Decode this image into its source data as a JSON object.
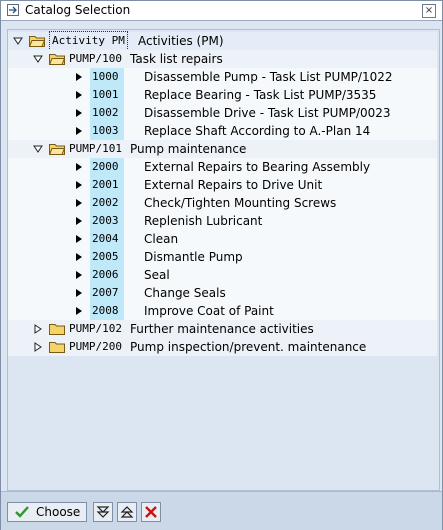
{
  "window": {
    "title": "Catalog Selection"
  },
  "root": {
    "code": "Activity PM",
    "desc": "Activities (PM)"
  },
  "groups": [
    {
      "code": "PUMP/100",
      "desc": "Task list repairs",
      "expanded": true,
      "items": [
        {
          "num": "1000",
          "desc": "Disassemble Pump - Task List PUMP/1022"
        },
        {
          "num": "1001",
          "desc": "Replace Bearing - Task List PUMP/3535"
        },
        {
          "num": "1002",
          "desc": "Disassemble Drive - Task List PUMP/0023"
        },
        {
          "num": "1003",
          "desc": "Replace Shaft According to A.-Plan 14"
        }
      ]
    },
    {
      "code": "PUMP/101",
      "desc": "Pump maintenance",
      "expanded": true,
      "items": [
        {
          "num": "2000",
          "desc": "External Repairs to Bearing Assembly"
        },
        {
          "num": "2001",
          "desc": "External Repairs to Drive Unit"
        },
        {
          "num": "2002",
          "desc": "Check/Tighten Mounting Screws"
        },
        {
          "num": "2003",
          "desc": "Replenish Lubricant"
        },
        {
          "num": "2004",
          "desc": "Clean"
        },
        {
          "num": "2005",
          "desc": "Dismantle Pump"
        },
        {
          "num": "2006",
          "desc": "Seal"
        },
        {
          "num": "2007",
          "desc": "Change Seals"
        },
        {
          "num": "2008",
          "desc": "Improve Coat of Paint"
        }
      ]
    },
    {
      "code": "PUMP/102",
      "desc": "Further maintenance activities",
      "expanded": false,
      "items": []
    },
    {
      "code": "PUMP/200",
      "desc": "Pump inspection/prevent. maintenance",
      "expanded": false,
      "items": []
    }
  ],
  "toolbar": {
    "choose_label": "Choose",
    "icons": [
      "expand-all-icon",
      "collapse-all-icon",
      "cancel-icon"
    ]
  },
  "colors": {
    "selection": "#bfe8f8",
    "background": "#dbe6f2",
    "checkmark": "#2a9a2a",
    "cancel": "#cc1111"
  }
}
